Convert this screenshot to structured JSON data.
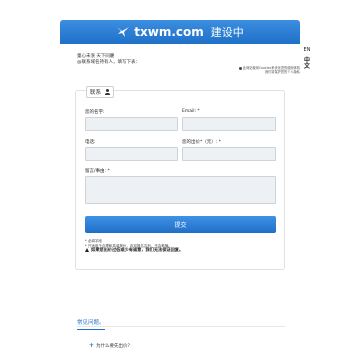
{
  "header": {
    "brand": "txwm.com",
    "subtitle": "建设中"
  },
  "language": {
    "en": "EN",
    "zh": "中文"
  },
  "intro": {
    "line1": "童心未泯 天下同慶",
    "line2": "@联系域名持有人，填写下表："
  },
  "privacy_note": {
    "line1": "此网站使用Cookies来优化您的使用体验",
    "line2": "我们将保护您的个人隐私"
  },
  "form": {
    "legend": "联系",
    "name_label": "您的名字:",
    "email_label": "Email: *",
    "phone_label": "电话:",
    "offer_label": "您的出价*（元）: *",
    "message_label": "留言/事由: *",
    "submit_label": "提交",
    "required_note": "* 必填字段",
    "note1": "* 只适用于合理和真诚报价，欢迎报名吉利，不会欺骗。",
    "warning": "如果您出价过低或少有诚意，我们无法保证回复。"
  },
  "faq": {
    "title": "常见问题。",
    "items": [
      {
        "question": "为什么要先出价？"
      }
    ]
  }
}
